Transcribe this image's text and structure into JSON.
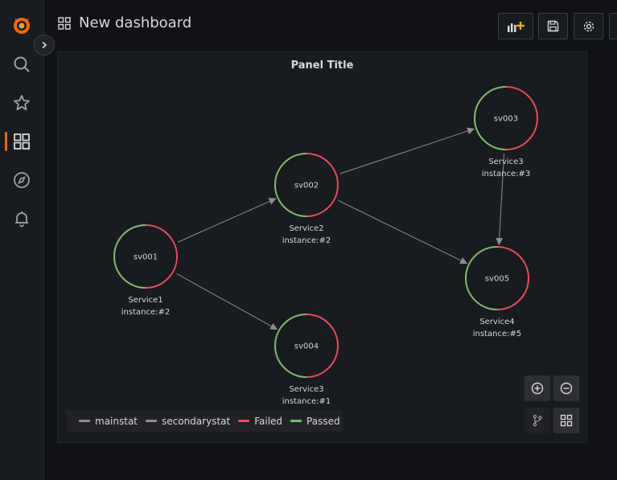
{
  "header": {
    "title": "New dashboard"
  },
  "panel": {
    "title": "Panel Title"
  },
  "nodes": [
    {
      "id": "sv001",
      "title": "Service1",
      "subtitle": "instance:#2",
      "passed": 0.5
    },
    {
      "id": "sv002",
      "title": "Service2",
      "subtitle": "instance:#2",
      "passed": 0.5
    },
    {
      "id": "sv003",
      "title": "Service3",
      "subtitle": "instance:#3",
      "passed": 0.5
    },
    {
      "id": "sv004",
      "title": "Service3",
      "subtitle": "instance:#1",
      "passed": 0.5
    },
    {
      "id": "sv005",
      "title": "Service4",
      "subtitle": "instance:#5",
      "passed": 0.5
    }
  ],
  "edges": [
    {
      "source": "sv001",
      "target": "sv002"
    },
    {
      "source": "sv001",
      "target": "sv004"
    },
    {
      "source": "sv002",
      "target": "sv003"
    },
    {
      "source": "sv002",
      "target": "sv005"
    },
    {
      "source": "sv003",
      "target": "sv005"
    }
  ],
  "legend": {
    "items": [
      {
        "label": "mainstat",
        "color": "#8e8e8e"
      },
      {
        "label": "secondarystat",
        "color": "#8e8e8e"
      },
      {
        "label": "Failed",
        "color": "#f2495c"
      },
      {
        "label": "Passed",
        "color": "#73bf69"
      }
    ]
  },
  "colors": {
    "failed": "#f2495c",
    "passed": "#73bf69",
    "brand": "#f46800"
  }
}
